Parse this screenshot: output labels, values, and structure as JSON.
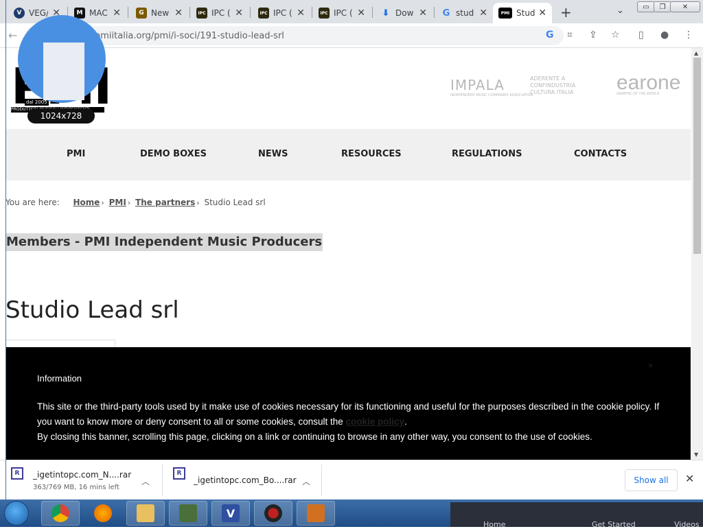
{
  "browser": {
    "tabs": [
      {
        "title": "VEG/",
        "icon": "V",
        "color": "#1f3a6b",
        "active": false
      },
      {
        "title": "MAC",
        "icon": "M",
        "color": "#111111",
        "active": false
      },
      {
        "title": "New",
        "icon": "G",
        "color": "#7a5a00",
        "active": false
      },
      {
        "title": "IPC (",
        "icon": "IPC",
        "color": "#2e2a10",
        "active": false
      },
      {
        "title": "IPC (",
        "icon": "IPC",
        "color": "#2e2a10",
        "active": false
      },
      {
        "title": "IPC (",
        "icon": "IPC",
        "color": "#2e2a10",
        "active": false
      },
      {
        "title": "Dow",
        "icon": "download",
        "color": "#1a73e8",
        "active": false
      },
      {
        "title": "stud",
        "icon": "G",
        "color": "#4285f4",
        "active": false
      },
      {
        "title": "Stud",
        "icon": "PMI",
        "color": "#000000",
        "active": true
      }
    ],
    "url": "pmiitalia.org/pmi/i-soci/191-studio-lead-srl"
  },
  "header": {
    "logo_text": "PMI",
    "logo_since": "dal 2005",
    "logo_strip": "PRODUTTORI MUSICALI INDIPENDENTI",
    "partners": [
      {
        "name": "IMPALA",
        "sub": "INDEPENDENT MUSIC COMPANIES ASSOCIATION"
      },
      {
        "name": "ADERENTE A CONFINDUSTRIA CULTURA ITALIA"
      },
      {
        "name": "earone",
        "sub": "GRAPHIC OF THE WORLD"
      }
    ]
  },
  "nav": {
    "items": [
      "PMI",
      "DEMO BOXES",
      "NEWS",
      "RESOURCES",
      "REGULATIONS",
      "CONTACTS"
    ]
  },
  "breadcrumb": {
    "prefix": "You are here:",
    "links": [
      "Home",
      "PMI",
      "The partners"
    ],
    "current": "Studio Lead srl"
  },
  "section_title": "Members - PMI Independent Music Producers",
  "page_title": "Studio Lead srl",
  "cookie": {
    "heading": "Information",
    "body_1": "This site or the third-party tools used by it make use of cookies necessary for its functioning and useful for the purposes described in the cookie policy. If you want to know more or deny consent to all or some cookies, consult the",
    "link": "cookie policy",
    "body_2": ".",
    "body_3": "By closing this banner, scrolling this page, clicking on a link or continuing to browse in any other way, you consent to the use of cookies.",
    "close": "×"
  },
  "overlay": {
    "size_badge": "1024x728"
  },
  "downloads": {
    "items": [
      {
        "name": "_igetintopc.com_N....rar",
        "status": "363/769 MB, 16 mins left"
      },
      {
        "name": "_igetintopc.com_Bo....rar",
        "status": ""
      }
    ],
    "show_all": "Show all"
  },
  "taskbar": {
    "panel_items": [
      "Home",
      "Get Started",
      "Videos"
    ]
  }
}
